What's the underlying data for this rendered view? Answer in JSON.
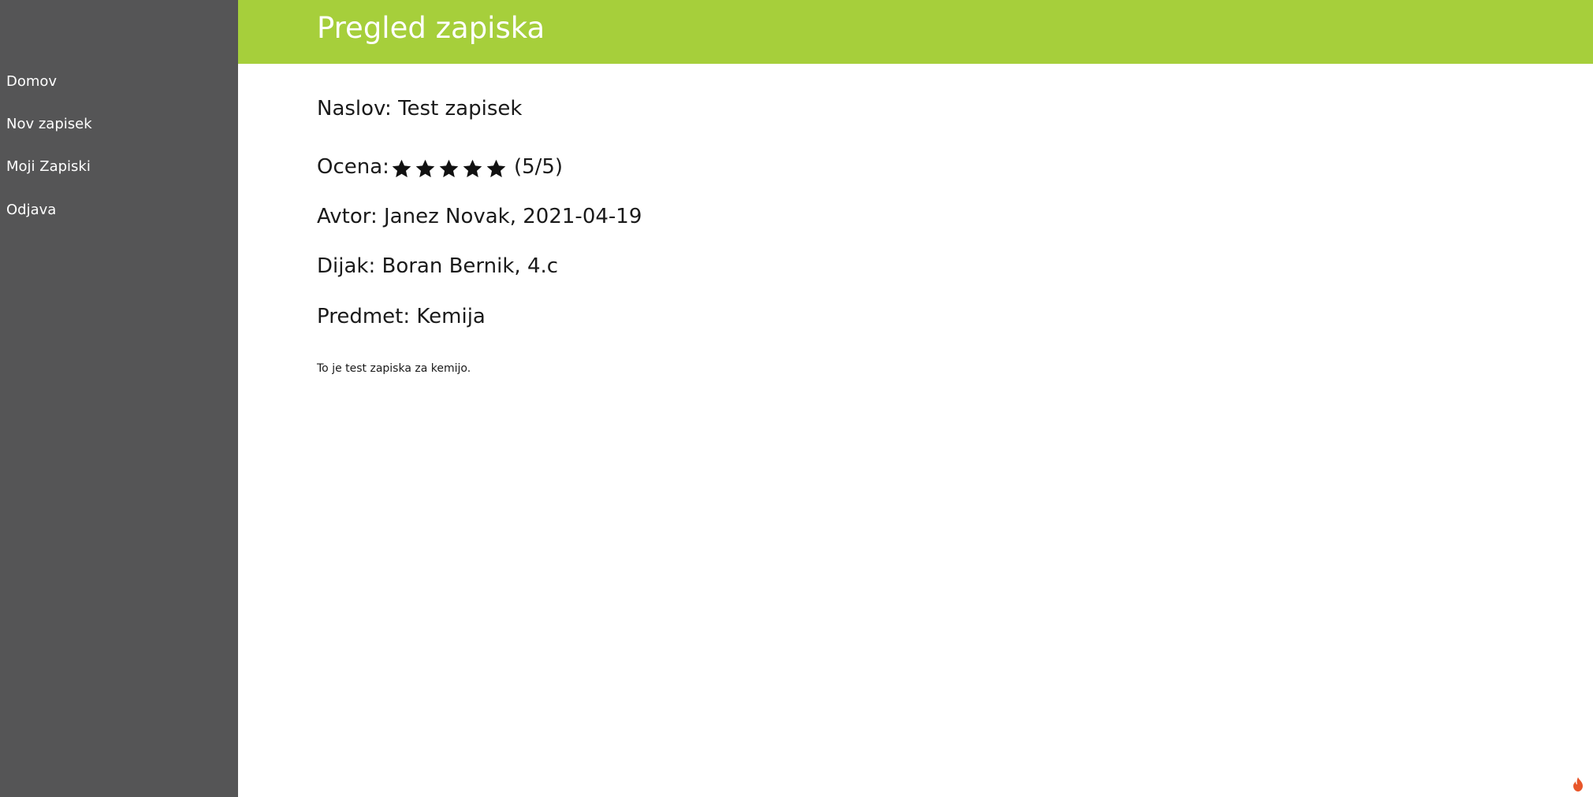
{
  "sidebar": {
    "items": [
      {
        "label": "Domov"
      },
      {
        "label": "Nov zapisek"
      },
      {
        "label": "Moji Zapiski"
      },
      {
        "label": "Odjava"
      }
    ]
  },
  "header": {
    "title": "Pregled zapiska"
  },
  "note": {
    "title_label": "Naslov:",
    "title_value": "Test zapisek",
    "rating_label": "Ocena:",
    "rating_value": 5,
    "rating_max": 5,
    "rating_text": "(5/5)",
    "author_label": "Avtor:",
    "author_value": "Janez Novak, 2021-04-19",
    "student_label": "Dijak:",
    "student_value": "Boran Bernik, 4.c",
    "subject_label": "Predmet:",
    "subject_value": "Kemija",
    "body": "To je test zapiska za kemijo."
  },
  "colors": {
    "header_bg": "#a6cf3b",
    "sidebar_bg": "#555556",
    "star": "#111111",
    "flame": "#e8562a"
  },
  "icons": {
    "star": "star-icon",
    "corner": "flame-icon"
  }
}
